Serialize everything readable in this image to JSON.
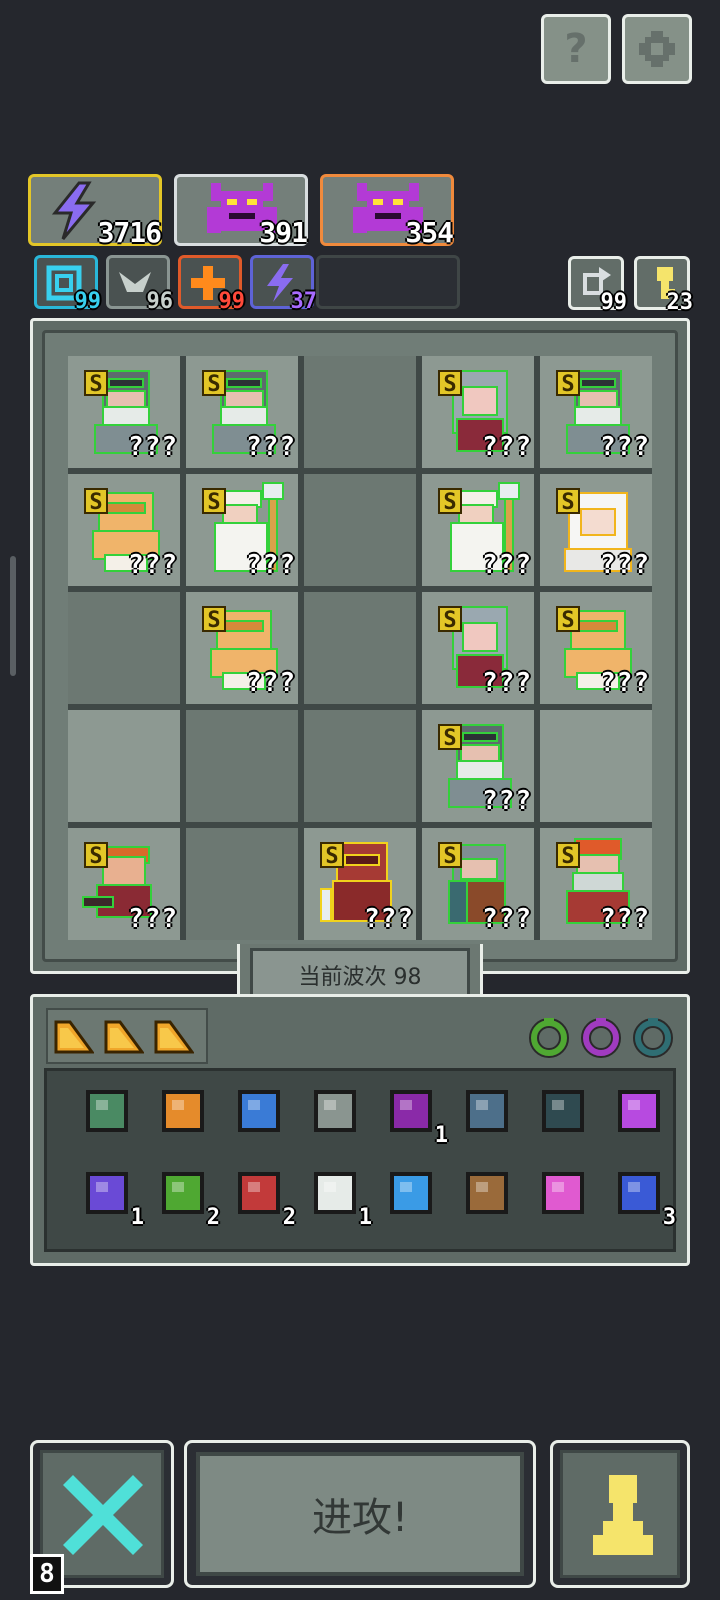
{
  "top_buttons": {
    "help_icon": "?",
    "settings_icon": "gear"
  },
  "resources": [
    {
      "name": "lightning-energy",
      "value": "3716",
      "border": "#e3c627"
    },
    {
      "name": "demon-boss-purple",
      "value": "391",
      "border": "#d9dee0"
    },
    {
      "name": "demon-boss-orange",
      "value": "354",
      "border": "#f08a3c"
    }
  ],
  "skills": [
    {
      "name": "spiral-skill",
      "value": "99",
      "border": "#29b7d9",
      "color": "#38d0ee"
    },
    {
      "name": "wing-skill",
      "value": "96",
      "border": "#8a9592",
      "color": "#c7d0cc"
    },
    {
      "name": "plus-skill",
      "value": "99",
      "border": "#e05a2a",
      "color": "#ff4a3a"
    },
    {
      "name": "bolt-skill",
      "value": "37",
      "border": "#5e63d6",
      "color": "#a86bff"
    }
  ],
  "counters": [
    {
      "name": "refresh-counter",
      "value": "99"
    },
    {
      "name": "key-counter",
      "value": "23"
    }
  ],
  "board": {
    "wave_label": "当前波次 98",
    "unknown_text": "???",
    "rank_text": "S",
    "units": [
      {
        "row": 0,
        "col": 0,
        "kind": "knight",
        "glow": "#34d13b"
      },
      {
        "row": 0,
        "col": 1,
        "kind": "knight",
        "glow": "#34d13b"
      },
      {
        "row": 0,
        "col": 3,
        "kind": "mage-girl",
        "glow": "#34d13b"
      },
      {
        "row": 0,
        "col": 4,
        "kind": "knight",
        "glow": "#34d13b"
      },
      {
        "row": 1,
        "col": 0,
        "kind": "brute",
        "glow": "#34d13b"
      },
      {
        "row": 1,
        "col": 1,
        "kind": "priest",
        "glow": "#34d13b"
      },
      {
        "row": 1,
        "col": 3,
        "kind": "priest",
        "glow": "#34d13b"
      },
      {
        "row": 1,
        "col": 4,
        "kind": "angel",
        "glow": "#f1b51c"
      },
      {
        "row": 2,
        "col": 1,
        "kind": "brute",
        "glow": "#34d13b"
      },
      {
        "row": 2,
        "col": 3,
        "kind": "mage-girl",
        "glow": "#34d13b"
      },
      {
        "row": 2,
        "col": 4,
        "kind": "brute",
        "glow": "#34d13b"
      },
      {
        "row": 3,
        "col": 3,
        "kind": "knight",
        "glow": "#34d13b"
      },
      {
        "row": 4,
        "col": 0,
        "kind": "warrior",
        "glow": "#34d13b"
      },
      {
        "row": 4,
        "col": 2,
        "kind": "red-armor",
        "glow": "#f1d21c"
      },
      {
        "row": 4,
        "col": 3,
        "kind": "shield-guard",
        "glow": "#34d13b"
      },
      {
        "row": 4,
        "col": 4,
        "kind": "king",
        "glow": "#34d13b"
      }
    ]
  },
  "inventory": {
    "tabs": [
      "cheese-tab",
      "cheese-tab",
      "cheese-tab"
    ],
    "rings": [
      {
        "name": "green-ring",
        "color": "#4fa832"
      },
      {
        "name": "purple-ring",
        "color": "#a03bc0"
      },
      {
        "name": "teal-ring",
        "color": "#2f6e73"
      }
    ],
    "items": [
      {
        "name": "green-helmet",
        "count": "",
        "color": "#4a8a63"
      },
      {
        "name": "scroll",
        "count": "",
        "color": "#e58b2b"
      },
      {
        "name": "blue-amulet",
        "count": "",
        "color": "#3a7bd6"
      },
      {
        "name": "grey-hammer",
        "count": "",
        "color": "#8a9590"
      },
      {
        "name": "demon-mask",
        "count": "1",
        "color": "#8a2aa8"
      },
      {
        "name": "crystal-crown",
        "count": "",
        "color": "#4d6f8a"
      },
      {
        "name": "dark-bell",
        "count": "",
        "color": "#2f4a50"
      },
      {
        "name": "purple-staff",
        "count": "",
        "color": "#b74ae0"
      },
      {
        "name": "potion-jar",
        "count": "1",
        "color": "#6a4ad6"
      },
      {
        "name": "green-herb",
        "count": "2",
        "color": "#4fa832"
      },
      {
        "name": "red-gem",
        "count": "2",
        "color": "#c23a3a"
      },
      {
        "name": "white-wing",
        "count": "1",
        "color": "#e6ebe8"
      },
      {
        "name": "blue-wave",
        "count": "",
        "color": "#3a9be6"
      },
      {
        "name": "feather-quill",
        "count": "",
        "color": "#9a6a3a"
      },
      {
        "name": "pink-arrow",
        "count": "",
        "color": "#e05ad0"
      },
      {
        "name": "hourglass",
        "count": "3",
        "color": "#3a5ad6"
      }
    ]
  },
  "bottom": {
    "cancel_count": "8",
    "attack_label": "进攻!",
    "pawn_icon": "pawn"
  },
  "colors": {
    "background": "#25272d",
    "panel": "#5f6b66",
    "cell_light": "#8d9992",
    "cell_dark": "#6c7872",
    "accent_cyan": "#4fe0d8",
    "accent_yellow": "#f5e46b"
  }
}
